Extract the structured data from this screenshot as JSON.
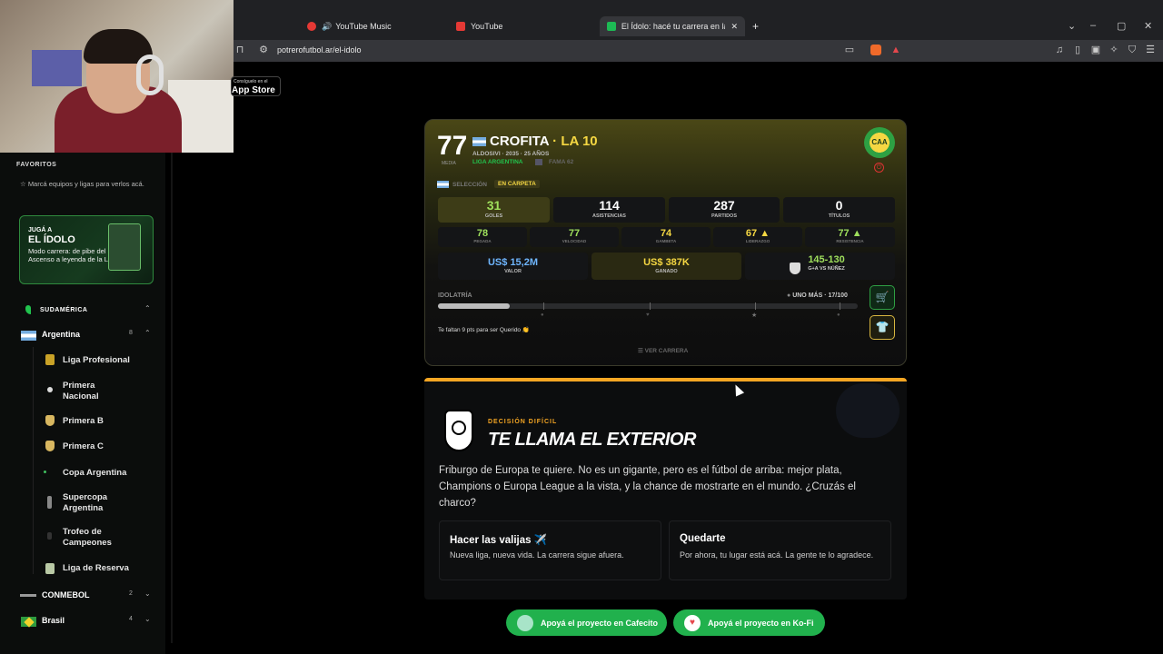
{
  "browser": {
    "tabs": [
      {
        "label": "YouTube Music"
      },
      {
        "label": "YouTube"
      },
      {
        "label": "El Ídolo: hacé tu carrera en la Liga"
      }
    ],
    "url": "potrerofutbol.ar/el-idolo",
    "add_tab": "+",
    "window_buttons": {
      "minimize": "–",
      "maximize": "▢",
      "close": "✕"
    }
  },
  "appstore": {
    "small": "Consíguelo en el",
    "big": "App Store"
  },
  "sidebar": {
    "favorites_title": "FAVORITOS",
    "favorites_hint": "Marcá equipos y ligas para verlos acá.",
    "promo": {
      "line1": "JUGÁ A",
      "line2": "EL ÍDOLO",
      "desc": "Modo carrera: de pibe del Ascenso a leyenda de la Liga"
    },
    "region": "SUDAMÉRICA",
    "country": {
      "name": "Argentina",
      "count": "8"
    },
    "leagues": [
      {
        "label": "Liga Profesional"
      },
      {
        "label": "Primera Nacional"
      },
      {
        "label": "Primera B"
      },
      {
        "label": "Primera C"
      },
      {
        "label": "Copa Argentina"
      },
      {
        "label": "Supercopa Argentina"
      },
      {
        "label": "Trofeo de Campeones"
      },
      {
        "label": "Liga de Reserva"
      }
    ],
    "conmebol": {
      "name": "CONMEBOL",
      "count": "2"
    },
    "brasil": {
      "name": "Brasil",
      "count": "4"
    }
  },
  "player": {
    "rating": "77",
    "rating_label": "MEDIA",
    "name": "CROFITA",
    "tag": "· LA 10",
    "club_line": "ALDOSIVI · 2035 · 25 AÑOS",
    "league": "LIGA ARGENTINA",
    "fame": "FAMA 62",
    "seleccion_label": "SELECCIÓN",
    "seleccion_status": "EN CARPETA",
    "club_badge": "CAA"
  },
  "stats": [
    {
      "value": "31",
      "label": "GOLES"
    },
    {
      "value": "114",
      "label": "ASISTENCIAS"
    },
    {
      "value": "287",
      "label": "PARTIDOS"
    },
    {
      "value": "0",
      "label": "TÍTULOS"
    }
  ],
  "attributes": [
    {
      "value": "78",
      "label": "PEGADA"
    },
    {
      "value": "77",
      "label": "VELOCIDAD"
    },
    {
      "value": "74",
      "label": "GAMBETA"
    },
    {
      "value": "67 ▲",
      "label": "LIDERAZGO"
    },
    {
      "value": "77 ▲",
      "label": "RESISTENCIA"
    }
  ],
  "money": {
    "valor": {
      "value": "US$ 15,2M",
      "label": "VALOR"
    },
    "ganado": {
      "value": "US$ 387K",
      "label": "GANADO"
    },
    "rival": {
      "value": "145-130",
      "label": "G+A VS NÚÑEZ"
    }
  },
  "idolatria": {
    "label": "IDOLATRÍA",
    "status": "UNO MÁS · 17/100",
    "progress": 0.17,
    "hint": "Te faltan 9 pts para ser Querido 👏",
    "ver_carrera": "VER CARRERA"
  },
  "decision": {
    "kicker": "DECISIÓN DIFÍCIL",
    "title": "TE LLAMA EL EXTERIOR",
    "body": "Friburgo de Europa te quiere. No es un gigante, pero es el fútbol de arriba: mejor plata, Champions o Europa League a la vista, y la chance de mostrarte en el mundo. ¿Cruzás el charco?",
    "options": [
      {
        "title": "Hacer las valijas ✈️",
        "subtitle": "Nueva liga, nueva vida. La carrera sigue afuera."
      },
      {
        "title": "Quedarte",
        "subtitle": "Por ahora, tu lugar está acá. La gente te lo agradece."
      }
    ]
  },
  "support": {
    "cafecito": "Apoyá el proyecto en Cafecito",
    "kofi": "Apoyá el proyecto en Ko-Fi"
  },
  "colors": {
    "accent_green": "#21b14d",
    "accent_yellow": "#f5d742",
    "orange_bar": "#f5a623"
  }
}
